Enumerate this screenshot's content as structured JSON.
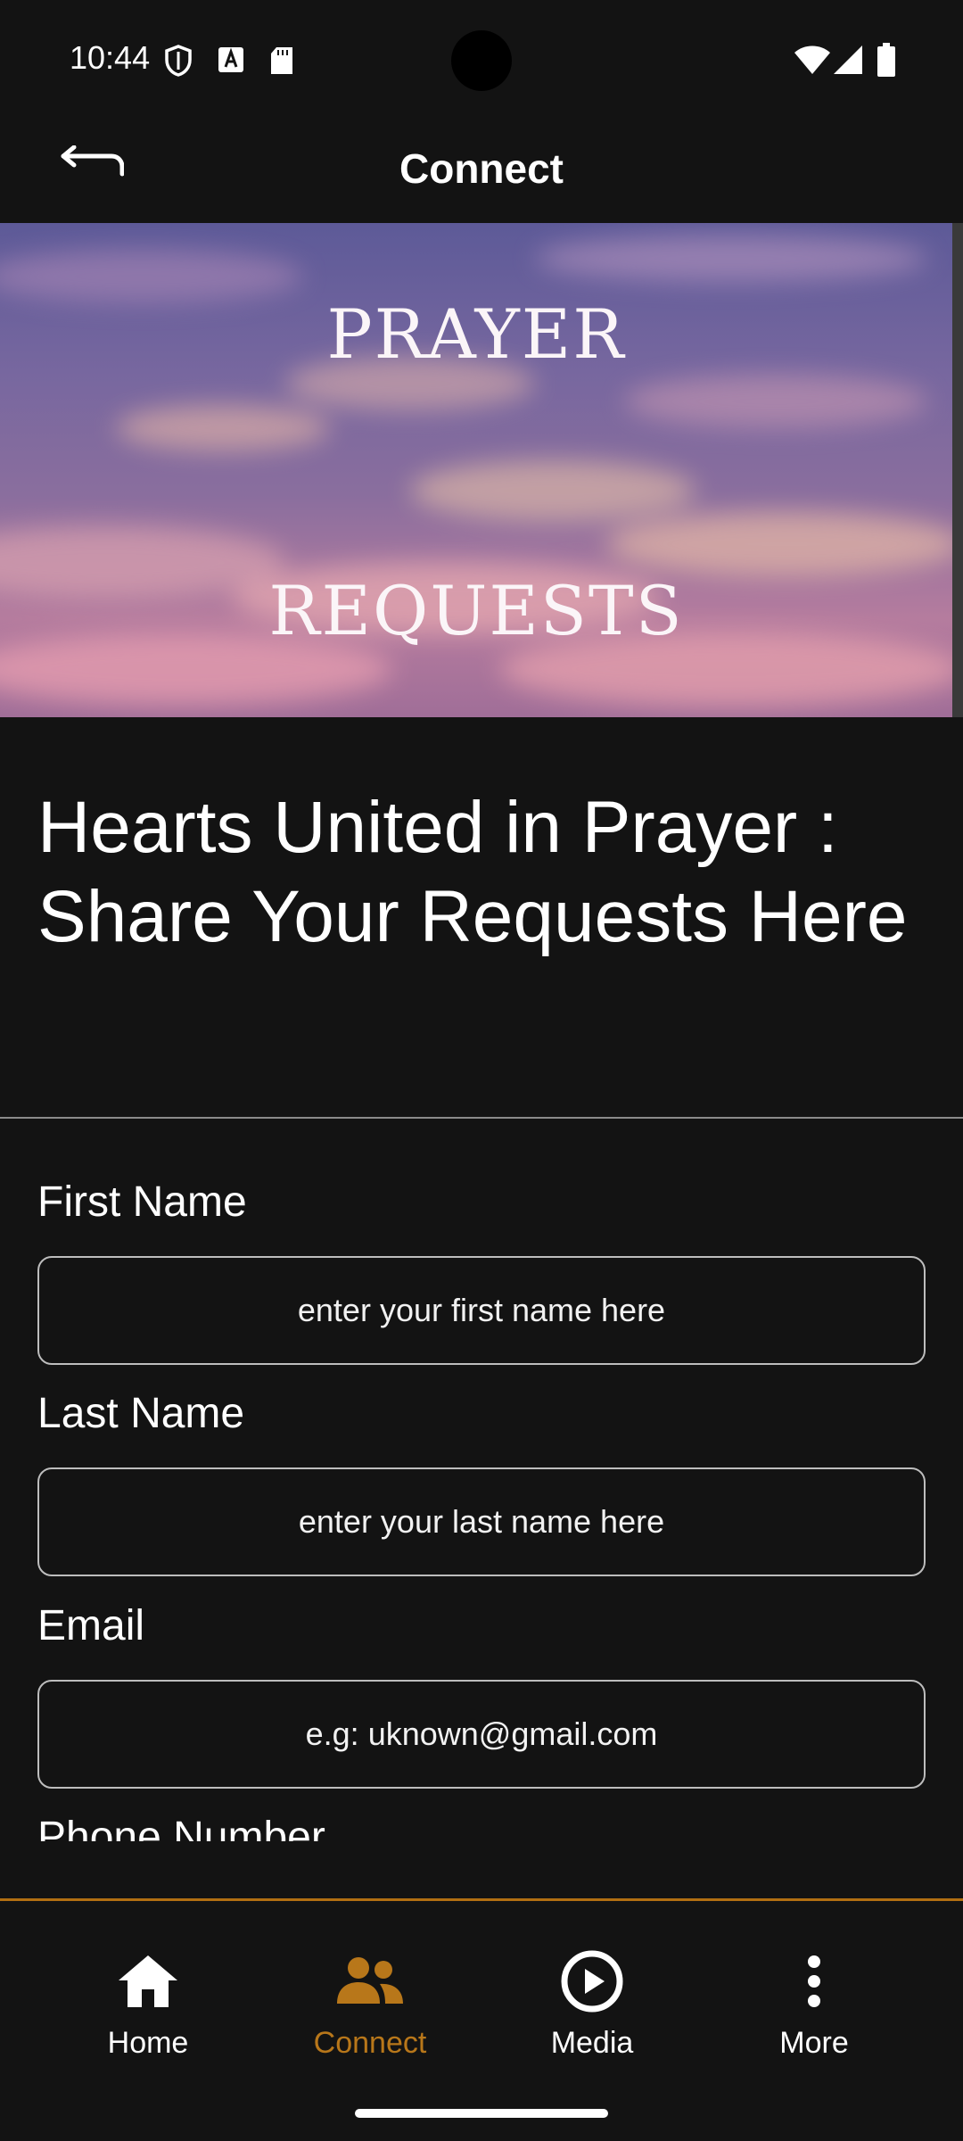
{
  "status_bar": {
    "time": "10:44",
    "left_icons": [
      "shield-icon",
      "text-a-icon",
      "sd-card-icon"
    ],
    "right_icons": [
      "wifi-icon",
      "signal-icon",
      "battery-icon"
    ]
  },
  "app_bar": {
    "title": "Connect",
    "back_icon": "back-arrow-icon"
  },
  "hero": {
    "line1": "PRAYER",
    "line2": "REQUESTS"
  },
  "heading": "Hearts United in Prayer : Share Your Requests Here",
  "form": {
    "first_name": {
      "label": "First Name",
      "placeholder": "enter your first name here",
      "value": ""
    },
    "last_name": {
      "label": "Last Name",
      "placeholder": "enter your last name here",
      "value": ""
    },
    "email": {
      "label": "Email",
      "placeholder": "e.g: uknown@gmail.com",
      "value": ""
    },
    "phone": {
      "label": "Phone Number"
    }
  },
  "bottom_nav": {
    "items": [
      {
        "label": "Home",
        "icon": "home-icon",
        "active": false
      },
      {
        "label": "Connect",
        "icon": "people-icon",
        "active": true
      },
      {
        "label": "Media",
        "icon": "play-circle-icon",
        "active": false
      },
      {
        "label": "More",
        "icon": "more-vertical-icon",
        "active": false
      }
    ]
  },
  "colors": {
    "background": "#131313",
    "accent": "#b8771a",
    "text": "#ffffff",
    "input_border": "#bdbdbd"
  }
}
